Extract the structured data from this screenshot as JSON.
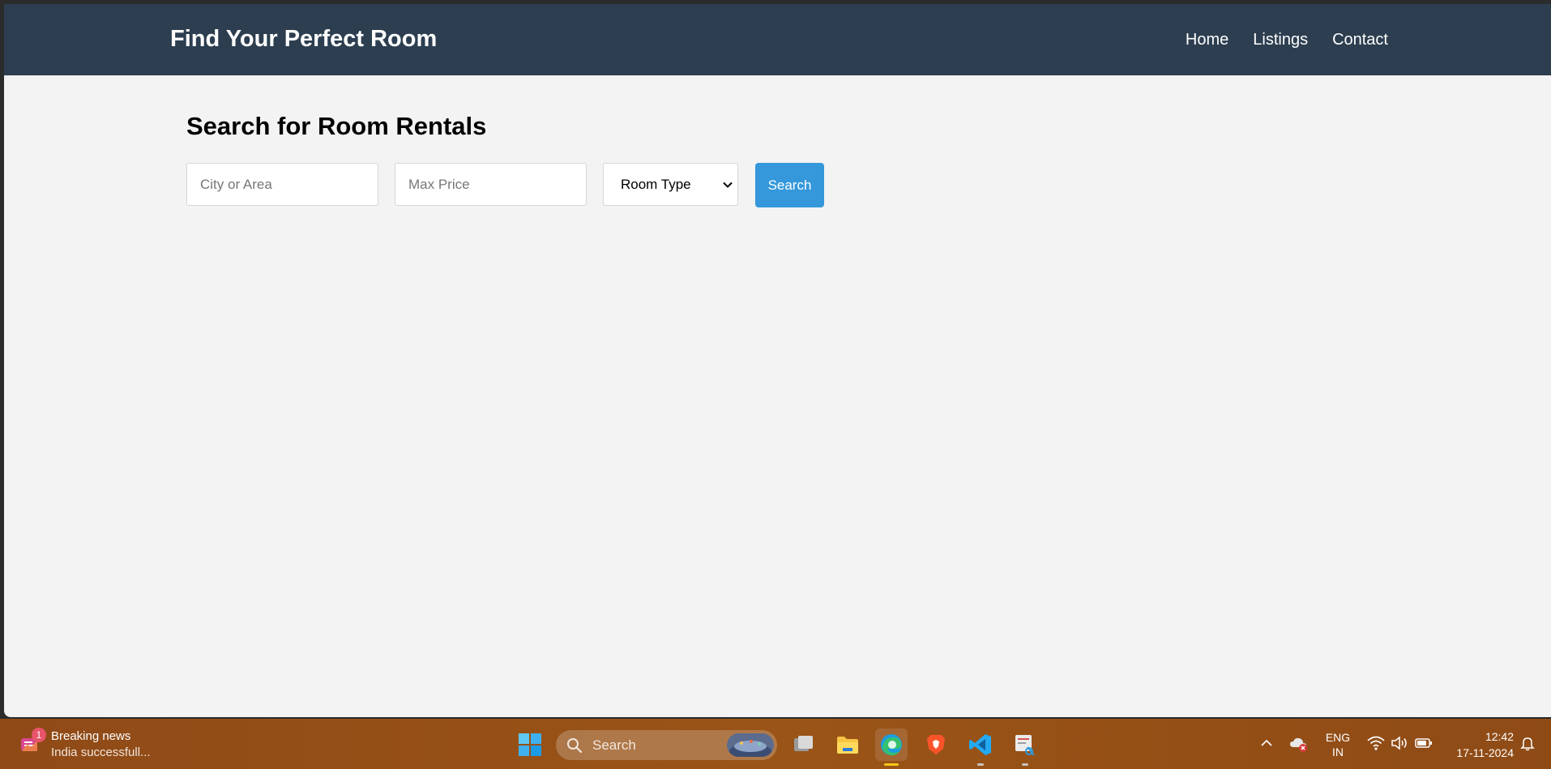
{
  "site": {
    "title": "Find Your Perfect Room",
    "nav": [
      {
        "label": "Home"
      },
      {
        "label": "Listings"
      },
      {
        "label": "Contact"
      }
    ]
  },
  "search": {
    "heading": "Search for Room Rentals",
    "city_placeholder": "City or Area",
    "price_placeholder": "Max Price",
    "room_type_selected": "Room Type",
    "button_label": "Search"
  },
  "colors": {
    "header_bg": "#2c3e50",
    "page_bg": "#f3f3f3",
    "button_bg": "#3498db",
    "taskbar_bg": "#9a5417"
  },
  "taskbar": {
    "news": {
      "badge": "1",
      "title": "Breaking news",
      "subtitle": "India successfull..."
    },
    "search_label": "Search",
    "apps": [
      "windows-start-icon",
      "task-view-icon",
      "file-explorer-icon",
      "edge-icon",
      "brave-icon",
      "vscode-icon",
      "snipping-tool-icon"
    ],
    "language": {
      "line1": "ENG",
      "line2": "IN"
    },
    "clock": {
      "time": "12:42",
      "date": "17-11-2024"
    }
  }
}
